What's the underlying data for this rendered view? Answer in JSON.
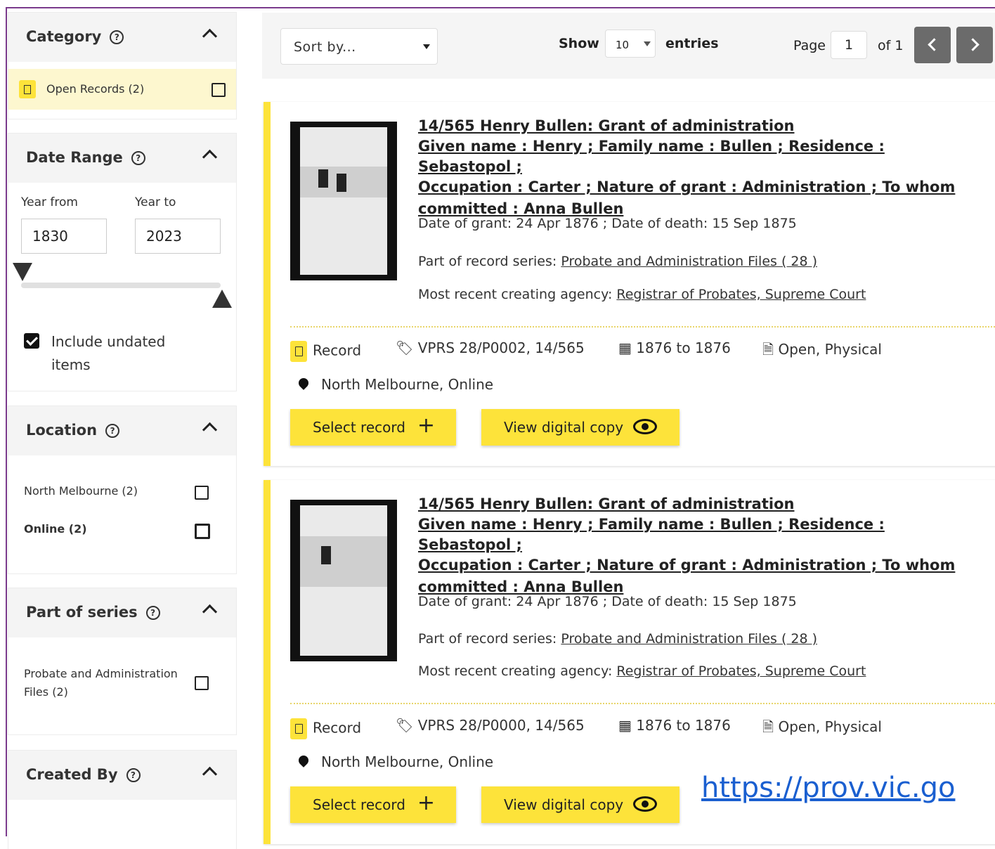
{
  "sidebar": {
    "category": {
      "title": "Category",
      "items": [
        {
          "label": "Open Records (2)"
        }
      ]
    },
    "date_range": {
      "title": "Date Range",
      "year_from_label": "Year from",
      "year_to_label": "Year to",
      "year_from": "1830",
      "year_to": "2023",
      "include_undated": "Include undated items"
    },
    "location": {
      "title": "Location",
      "items": [
        {
          "label": "North Melbourne (2)"
        },
        {
          "label": "Online (2)"
        }
      ]
    },
    "series": {
      "title": "Part of series",
      "items": [
        {
          "label": "Probate and Administration Files (2)"
        }
      ]
    },
    "created_by": {
      "title": "Created By"
    }
  },
  "toolbar": {
    "sort_placeholder": "Sort by...",
    "show_label": "Show",
    "entries_value": "10",
    "entries_label": "entries",
    "page_label": "Page",
    "page_value": "1",
    "page_of": "of 1"
  },
  "results": [
    {
      "title": "14/565 Henry Bullen: Grant of administration",
      "desc_line1": "Given name : Henry ; Family name : Bullen ; Residence : Sebastopol ;",
      "desc_line2": "Occupation : Carter ; Nature of grant : Administration ; To whom",
      "desc_line3": "committed : Anna Bullen",
      "dates": "Date of grant: 24 Apr 1876 ; Date of death: 15 Sep 1875",
      "series_prefix": "Part of record series: ",
      "series_link": "Probate and Administration Files ( 28 )",
      "agency_prefix": "Most recent creating agency: ",
      "agency_link": "Registrar of Probates, Supreme Court",
      "type": "Record",
      "id": "VPRS 28/P0002, 14/565",
      "range": "1876 to 1876",
      "access": "Open, Physical",
      "location": "North Melbourne, Online",
      "select_label": "Select record",
      "view_label": "View digital copy"
    },
    {
      "title": "14/565 Henry Bullen: Grant of administration",
      "desc_line1": "Given name : Henry ; Family name : Bullen ; Residence : Sebastopol ;",
      "desc_line2": "Occupation : Carter ; Nature of grant : Administration ; To whom",
      "desc_line3": "committed : Anna Bullen",
      "dates": "Date of grant: 24 Apr 1876 ; Date of death: 15 Sep 1875",
      "series_prefix": "Part of record series: ",
      "series_link": "Probate and Administration Files ( 28 )",
      "agency_prefix": "Most recent creating agency: ",
      "agency_link": "Registrar of Probates, Supreme Court",
      "type": "Record",
      "id": "VPRS 28/P0000, 14/565",
      "range": "1876 to 1876",
      "access": "Open, Physical",
      "location": "North Melbourne, Online",
      "select_label": "Select record",
      "view_label": "View digital copy"
    }
  ],
  "overlay_link": "https://prov.vic.go",
  "colors": {
    "accent": "#fde33a",
    "nav_button": "#6b6b6b",
    "frame": "#7a3a8c"
  },
  "icons": [
    "help-icon",
    "chevron-up-icon",
    "checkbox-icon",
    "tag-icon",
    "calendar-icon",
    "document-icon",
    "map-pin-icon",
    "plus-icon",
    "eye-icon",
    "chevron-left-icon",
    "chevron-right-icon"
  ]
}
